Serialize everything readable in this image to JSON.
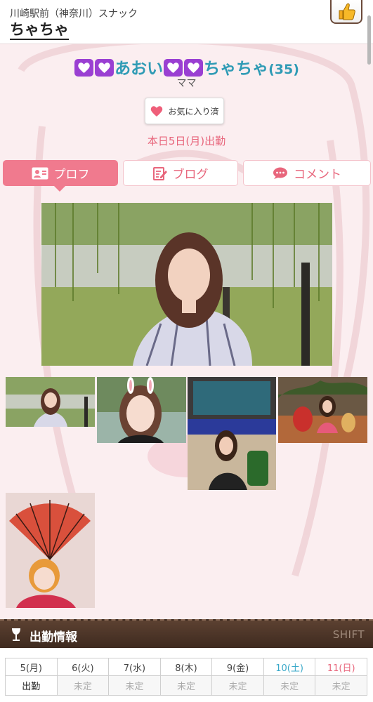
{
  "header": {
    "shop_area": "川崎駅前（神奈川）スナック",
    "shop_name": "ちゃちゃ"
  },
  "profile": {
    "name_part1": "あおい",
    "name_part2": "ちゃちゃ",
    "age": "(35)",
    "title": "ママ",
    "favorite_label": "お気に入り済",
    "today_shift": "本日5日(月)出勤"
  },
  "tabs": [
    {
      "label": "プロフ",
      "icon": "profile-card-icon",
      "active": true
    },
    {
      "label": "ブログ",
      "icon": "blog-edit-icon",
      "active": false
    },
    {
      "label": "コメント",
      "icon": "speech-bubble-icon",
      "active": false
    }
  ],
  "shift": {
    "title": "出勤情報",
    "subtitle": "SHIFT",
    "days": [
      {
        "label": "5(月)",
        "status": "出勤",
        "color": "#444444"
      },
      {
        "label": "6(火)",
        "status": "未定",
        "color": "#444444"
      },
      {
        "label": "7(水)",
        "status": "未定",
        "color": "#444444"
      },
      {
        "label": "8(木)",
        "status": "未定",
        "color": "#444444"
      },
      {
        "label": "9(金)",
        "status": "未定",
        "color": "#444444"
      },
      {
        "label": "10(土)",
        "status": "未定",
        "color": "#3aa9c9"
      },
      {
        "label": "11(日)",
        "status": "未定",
        "color": "#e8667c"
      }
    ]
  },
  "colors": {
    "accent_pink": "#f07a8e",
    "name_blue": "#2f9bb5",
    "heart_purple": "#9a3fd2",
    "shift_bar_brown": "#4a3326"
  }
}
